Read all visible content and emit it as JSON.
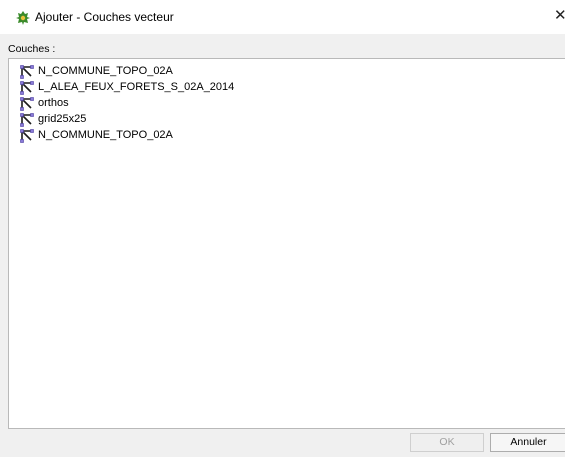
{
  "window": {
    "title": "Ajouter - Couches vecteur",
    "close_glyph": "✕",
    "icon": "add-vector-layer-icon",
    "icon_color": "#3a8a2a"
  },
  "list": {
    "label": "Couches :",
    "items": [
      {
        "label": "N_COMMUNE_TOPO_02A",
        "icon": "vector-polygon-icon"
      },
      {
        "label": "L_ALEA_FEUX_FORETS_S_02A_2014",
        "icon": "vector-polygon-icon"
      },
      {
        "label": "orthos",
        "icon": "vector-polygon-icon"
      },
      {
        "label": "grid25x25",
        "icon": "vector-polygon-icon"
      },
      {
        "label": "N_COMMUNE_TOPO_02A",
        "icon": "vector-polygon-icon"
      }
    ]
  },
  "buttons": {
    "ok_label": "OK",
    "ok_enabled": false,
    "cancel_label": "Annuler"
  }
}
